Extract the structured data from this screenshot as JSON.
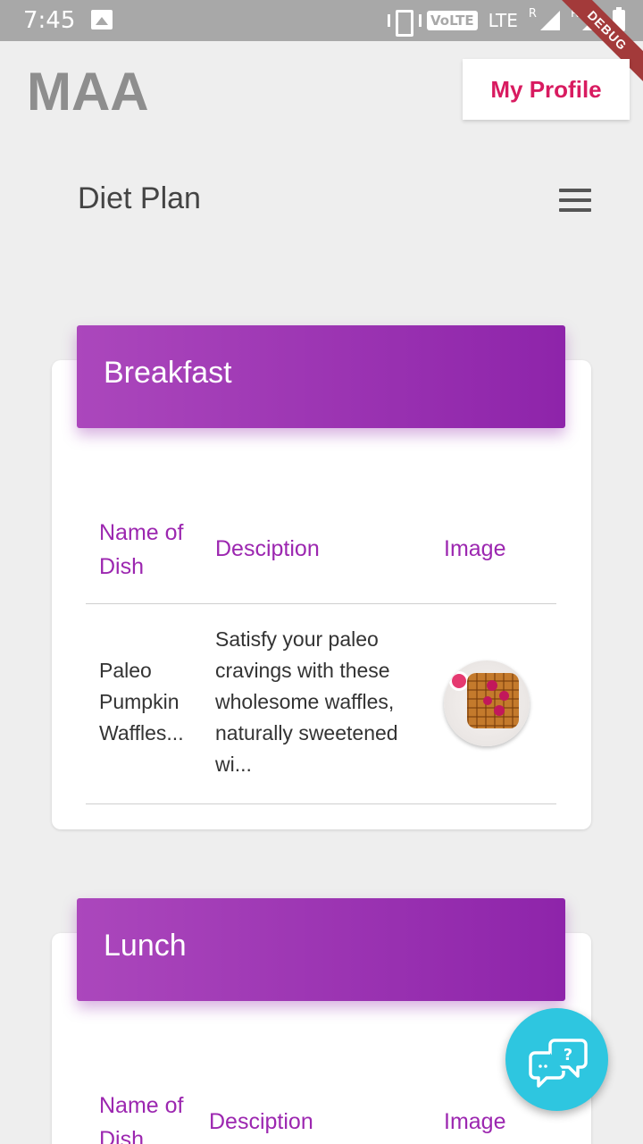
{
  "status_bar": {
    "time": "7:45",
    "network": "LTE",
    "volte": "VoLTE",
    "roaming": "R",
    "debug_banner": "DEBUG"
  },
  "header": {
    "logo": "MAA",
    "profile_button": "My Profile"
  },
  "page": {
    "title": "Diet Plan"
  },
  "meals": [
    {
      "title": "Breakfast",
      "columns": [
        "Name of Dish",
        "Desciption",
        "Image"
      ],
      "rows": [
        {
          "name": "Paleo Pumpkin Waffles...",
          "description": "Satisfy your paleo cravings with these wholesome waffles, naturally sweetened wi..."
        }
      ]
    },
    {
      "title": "Lunch",
      "columns": [
        "Name of Dish",
        "Desciption",
        "Image"
      ]
    }
  ],
  "fab": {
    "icon": "chat-help-icon"
  },
  "colors": {
    "accent": "#9c27b0",
    "header_gradient_start": "#ab47bc",
    "header_gradient_end": "#8e24aa",
    "profile_text": "#d81b60",
    "fab": "#2ec6e0"
  }
}
